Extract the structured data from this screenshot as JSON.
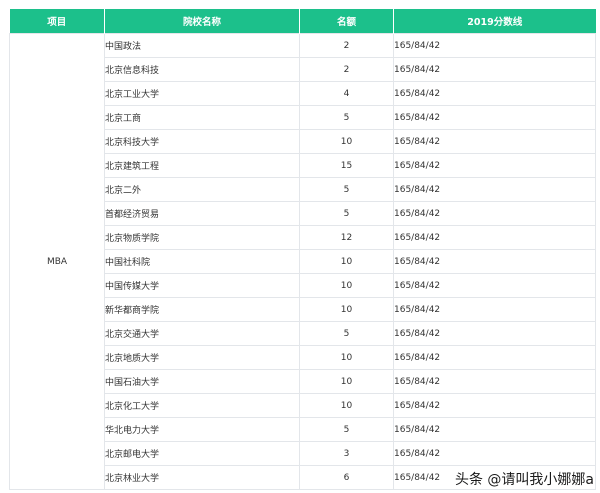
{
  "table": {
    "headers": [
      "项目",
      "院校名称",
      "名额",
      "2019分数线"
    ],
    "category": "MBA",
    "rows": [
      {
        "school": "中国政法",
        "quota": "2",
        "line": "165/84/42"
      },
      {
        "school": "北京信息科技",
        "quota": "2",
        "line": "165/84/42"
      },
      {
        "school": "北京工业大学",
        "quota": "4",
        "line": "165/84/42"
      },
      {
        "school": "北京工商",
        "quota": "5",
        "line": "165/84/42"
      },
      {
        "school": "北京科技大学",
        "quota": "10",
        "line": "165/84/42"
      },
      {
        "school": "北京建筑工程",
        "quota": "15",
        "line": "165/84/42"
      },
      {
        "school": "北京二外",
        "quota": "5",
        "line": "165/84/42"
      },
      {
        "school": "首都经济贸易",
        "quota": "5",
        "line": "165/84/42"
      },
      {
        "school": "北京物质学院",
        "quota": "12",
        "line": "165/84/42"
      },
      {
        "school": "中国社科院",
        "quota": "10",
        "line": "165/84/42"
      },
      {
        "school": "中国传媒大学",
        "quota": "10",
        "line": "165/84/42"
      },
      {
        "school": "新华都商学院",
        "quota": "10",
        "line": "165/84/42"
      },
      {
        "school": "北京交通大学",
        "quota": "5",
        "line": "165/84/42"
      },
      {
        "school": "北京地质大学",
        "quota": "10",
        "line": "165/84/42"
      },
      {
        "school": "中国石油大学",
        "quota": "10",
        "line": "165/84/42"
      },
      {
        "school": "北京化工大学",
        "quota": "10",
        "line": "165/84/42"
      },
      {
        "school": "华北电力大学",
        "quota": "5",
        "line": "165/84/42"
      },
      {
        "school": "北京邮电大学",
        "quota": "3",
        "line": "165/84/42"
      },
      {
        "school": "北京林业大学",
        "quota": "6",
        "line": "165/84/42"
      }
    ]
  },
  "watermark": "头条 @请叫我小娜娜a",
  "colors": {
    "header_bg": "#1cc08b",
    "border": "#e3e6ea",
    "text": "#333333"
  }
}
